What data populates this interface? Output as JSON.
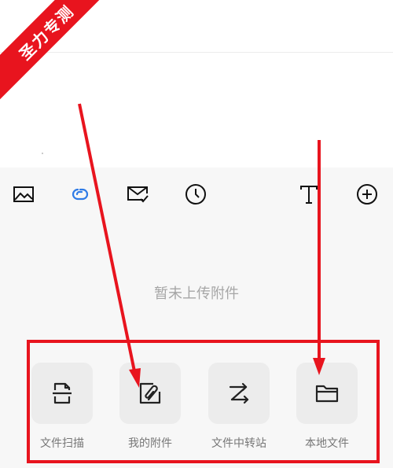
{
  "watermark": {
    "text": "圣力专测"
  },
  "toolbar": {
    "items": [
      {
        "icon": "image-icon"
      },
      {
        "icon": "link-icon",
        "color": "#2f7be6"
      },
      {
        "icon": "mail-check-icon"
      },
      {
        "icon": "clock-icon"
      },
      {
        "icon": "text-format-icon"
      },
      {
        "icon": "add-circle-icon"
      }
    ]
  },
  "attachments": {
    "empty_text": "暂未上传附件"
  },
  "actions": {
    "scan": {
      "label": "文件扫描",
      "icon": "document-scan-icon"
    },
    "my_attachments": {
      "label": "我的附件",
      "icon": "attachment-icon"
    },
    "transfer": {
      "label": "文件中转站",
      "icon": "transfer-icon"
    },
    "local": {
      "label": "本地文件",
      "icon": "folder-icon"
    }
  },
  "colors": {
    "annotation_red": "#e8141e",
    "accent_blue": "#2f7be6",
    "panel_bg": "#f7f7f7"
  }
}
